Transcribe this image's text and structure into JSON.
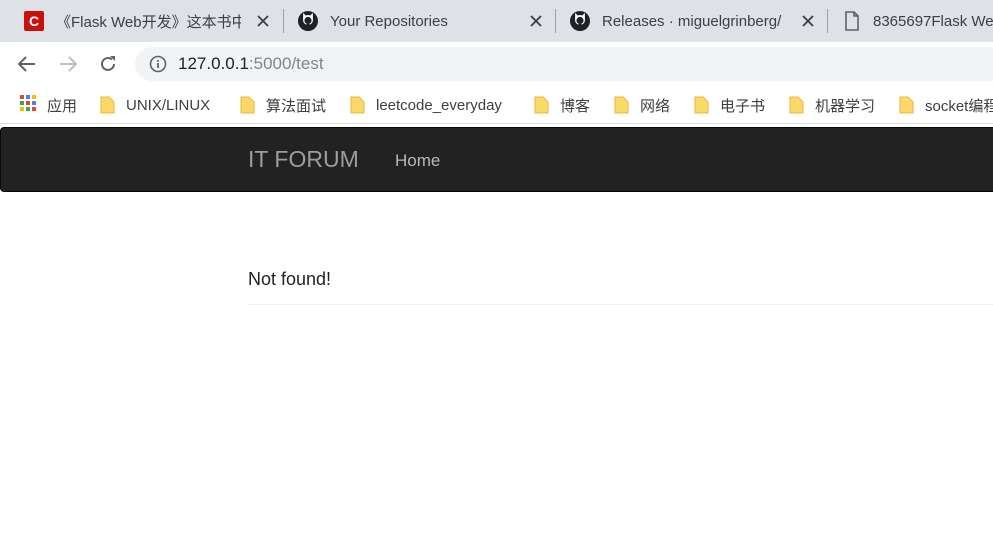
{
  "browser": {
    "tabs": [
      {
        "title": "《Flask Web开发》这本书中",
        "icon": "csdn-icon"
      },
      {
        "title": "Your Repositories",
        "icon": "github-icon"
      },
      {
        "title": "Releases · miguelgrinberg/",
        "icon": "github-icon"
      },
      {
        "title": "8365697Flask We",
        "icon": "document-icon"
      }
    ],
    "url": {
      "host": "127.0.0.1",
      "rest": ":5000/test"
    },
    "bookmarks": [
      {
        "label": "应用",
        "icon": "apps-grid-icon"
      },
      {
        "label": "UNIX/LINUX",
        "icon": "folder-icon"
      },
      {
        "label": "算法面试",
        "icon": "folder-icon"
      },
      {
        "label": "leetcode_everyday",
        "icon": "folder-icon"
      },
      {
        "label": "博客",
        "icon": "folder-icon"
      },
      {
        "label": "网络",
        "icon": "folder-icon"
      },
      {
        "label": "电子书",
        "icon": "folder-icon"
      },
      {
        "label": "机器学习",
        "icon": "folder-icon"
      },
      {
        "label": "socket编程",
        "icon": "folder-icon"
      }
    ]
  },
  "navbar": {
    "brand": "IT FORUM",
    "links": [
      "Home"
    ]
  },
  "main": {
    "heading": "Not found!"
  },
  "colors": {
    "tabstrip": "#dee1e6",
    "navbar_bg": "#222222",
    "navbar_text": "#9d9d9d",
    "folder": "#fcd869",
    "csdn_red": "#c9110b"
  }
}
